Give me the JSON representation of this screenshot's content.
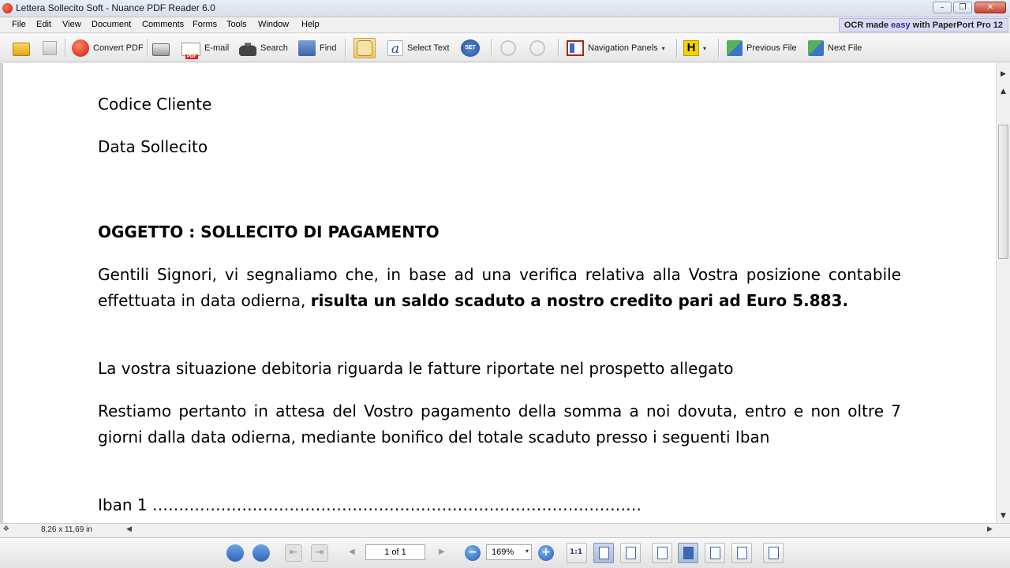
{
  "window": {
    "title": "Lettera Sollecito Soft - Nuance PDF Reader 6.0",
    "controls": {
      "minimize": "–",
      "restore": "❐",
      "close": "✕"
    }
  },
  "menu": {
    "items": [
      "File",
      "Edit",
      "View",
      "Document",
      "Comments",
      "Forms",
      "Tools",
      "Window",
      "Help"
    ],
    "promo_prefix": "OCR made ",
    "promo_highlight": "easy",
    "promo_suffix": " with PaperPort Pro 12"
  },
  "toolbar": {
    "convert_pdf": "Convert PDF",
    "email": "E-mail",
    "search": "Search",
    "find": "Find",
    "select_text": "Select Text",
    "set_icon_text": "SET",
    "navigation_panels": "Navigation Panels",
    "highlight_icon_text": "H",
    "previous_file": "Previous File",
    "next_file": "Next File"
  },
  "document": {
    "line_codice": "Codice Cliente",
    "line_data": "Data Sollecito",
    "subject": "OGGETTO : SOLLECITO DI PAGAMENTO",
    "para1_normal": "Gentili Signori, vi segnaliamo che, in base ad una verifica relativa alla Vostra posizione contabile effettuata in data odierna, ",
    "para1_bold": "risulta un saldo scaduto a nostro credito pari ad Euro 5.883.",
    "para2": "La vostra situazione debitoria riguarda le fatture riportate nel prospetto allegato",
    "para3": "Restiamo pertanto in attesa del Vostro pagamento della somma a noi dovuta, entro e non oltre 7 giorni dalla data odierna, mediante bonifico del totale scaduto presso i seguenti Iban",
    "iban_line": "Iban 1 …………………………………………………………………………………"
  },
  "status": {
    "page_size": "8,26 x 11,69 in"
  },
  "bottom": {
    "page_indicator": "1 of 1",
    "zoom_level": "169%",
    "actual_size_label": "1:1"
  }
}
